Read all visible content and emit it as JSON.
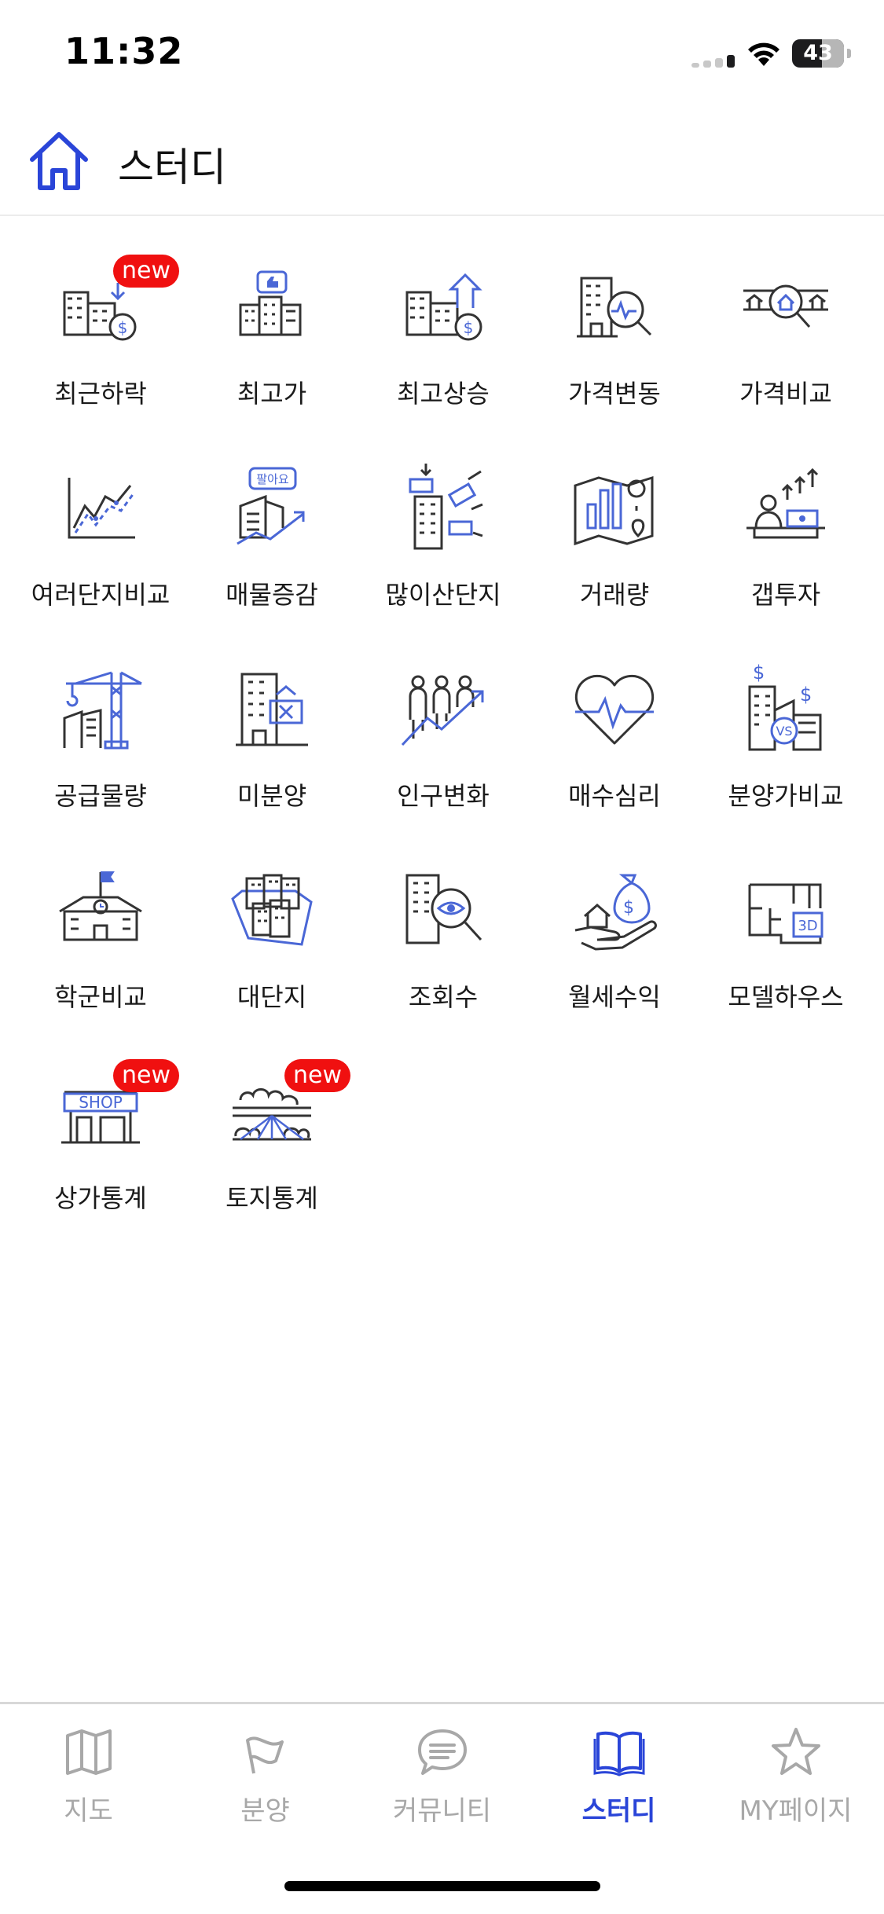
{
  "status_bar": {
    "time": "11:32",
    "battery": "43"
  },
  "header": {
    "title": "스터디"
  },
  "grid": {
    "items": [
      {
        "label": "최근하락",
        "badge": "new",
        "icon": "price-drop-icon"
      },
      {
        "label": "최고가",
        "icon": "highest-price-icon"
      },
      {
        "label": "최고상승",
        "icon": "highest-rise-icon"
      },
      {
        "label": "가격변동",
        "icon": "price-change-icon"
      },
      {
        "label": "가격비교",
        "icon": "price-compare-icon"
      },
      {
        "label": "여러단지비교",
        "icon": "multi-complex-compare-icon"
      },
      {
        "label": "매물증감",
        "icon": "listing-change-icon",
        "icon_text": "팔아요"
      },
      {
        "label": "많이산단지",
        "icon": "most-bought-icon"
      },
      {
        "label": "거래량",
        "icon": "trade-volume-icon"
      },
      {
        "label": "갭투자",
        "icon": "gap-investment-icon"
      },
      {
        "label": "공급물량",
        "icon": "supply-volume-icon"
      },
      {
        "label": "미분양",
        "icon": "unsold-icon"
      },
      {
        "label": "인구변화",
        "icon": "population-change-icon"
      },
      {
        "label": "매수심리",
        "icon": "buyer-sentiment-icon"
      },
      {
        "label": "분양가비교",
        "icon": "presale-price-compare-icon",
        "icon_text": "VS"
      },
      {
        "label": "학군비교",
        "icon": "school-district-icon"
      },
      {
        "label": "대단지",
        "icon": "large-complex-icon"
      },
      {
        "label": "조회수",
        "icon": "views-icon"
      },
      {
        "label": "월세수익",
        "icon": "rent-income-icon"
      },
      {
        "label": "모델하우스",
        "icon": "model-house-icon",
        "icon_text": "3D"
      },
      {
        "label": "상가통계",
        "badge": "new",
        "icon": "shop-stats-icon",
        "icon_text": "SHOP"
      },
      {
        "label": "토지통계",
        "badge": "new",
        "icon": "land-stats-icon"
      }
    ]
  },
  "tabbar": {
    "items": [
      {
        "label": "지도",
        "icon": "map-icon",
        "active": false
      },
      {
        "label": "분양",
        "icon": "flag-icon",
        "active": false
      },
      {
        "label": "커뮤니티",
        "icon": "chat-bubble-icon",
        "active": false
      },
      {
        "label": "스터디",
        "icon": "book-icon",
        "active": true
      },
      {
        "label": "MY페이지",
        "icon": "star-icon",
        "active": false
      }
    ]
  },
  "colors": {
    "accent": "#2a45d8",
    "icon_blue": "#4a67d6",
    "badge": "#f01010",
    "inactive": "#a8a8a8"
  }
}
